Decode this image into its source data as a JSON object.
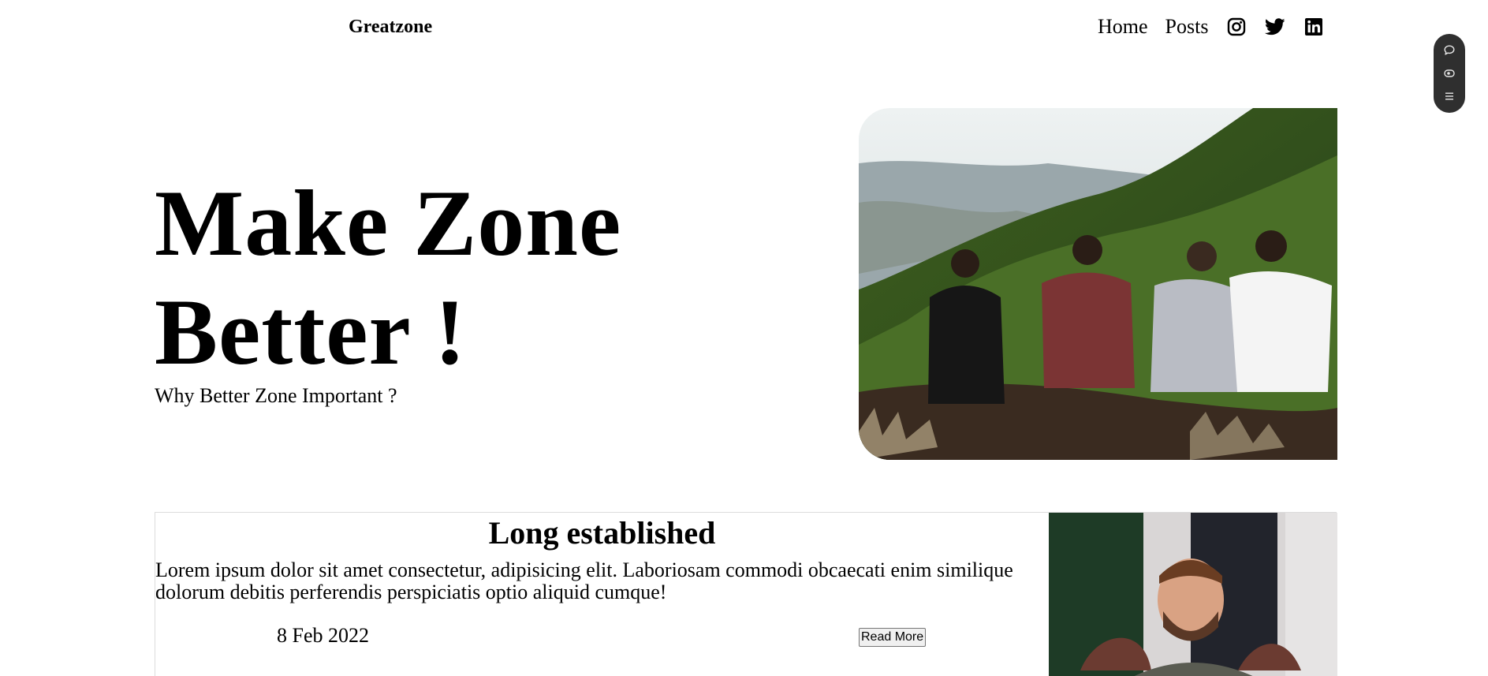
{
  "header": {
    "brand": "Greatzone",
    "nav": [
      {
        "label": "Home"
      },
      {
        "label": "Posts"
      }
    ],
    "social_icons": [
      "instagram-icon",
      "twitter-icon",
      "linkedin-icon"
    ]
  },
  "floating_toolbar": {
    "icons": [
      "chat-icon",
      "eye-icon",
      "menu-icon"
    ]
  },
  "hero": {
    "title_line1": "Make Zone",
    "title_line2": "Better !",
    "subtitle": "Why Better Zone Important ?",
    "image_alt": "four friends sitting on a green mountain ridge"
  },
  "post": {
    "title": "Long established",
    "excerpt": "Lorem ipsum dolor sit amet consectetur, adipisicing elit. Laboriosam commodi obcaecati enim similique dolorum debitis perferendis perspiciatis optio aliquid cumque!",
    "date": "8 Feb 2022",
    "button_label": "Read More",
    "image_alt": "man smiling at a laptop"
  },
  "colors": {
    "text": "#000000",
    "pill_bg": "#2f2f2f",
    "card_border": "#dcdcdc"
  }
}
